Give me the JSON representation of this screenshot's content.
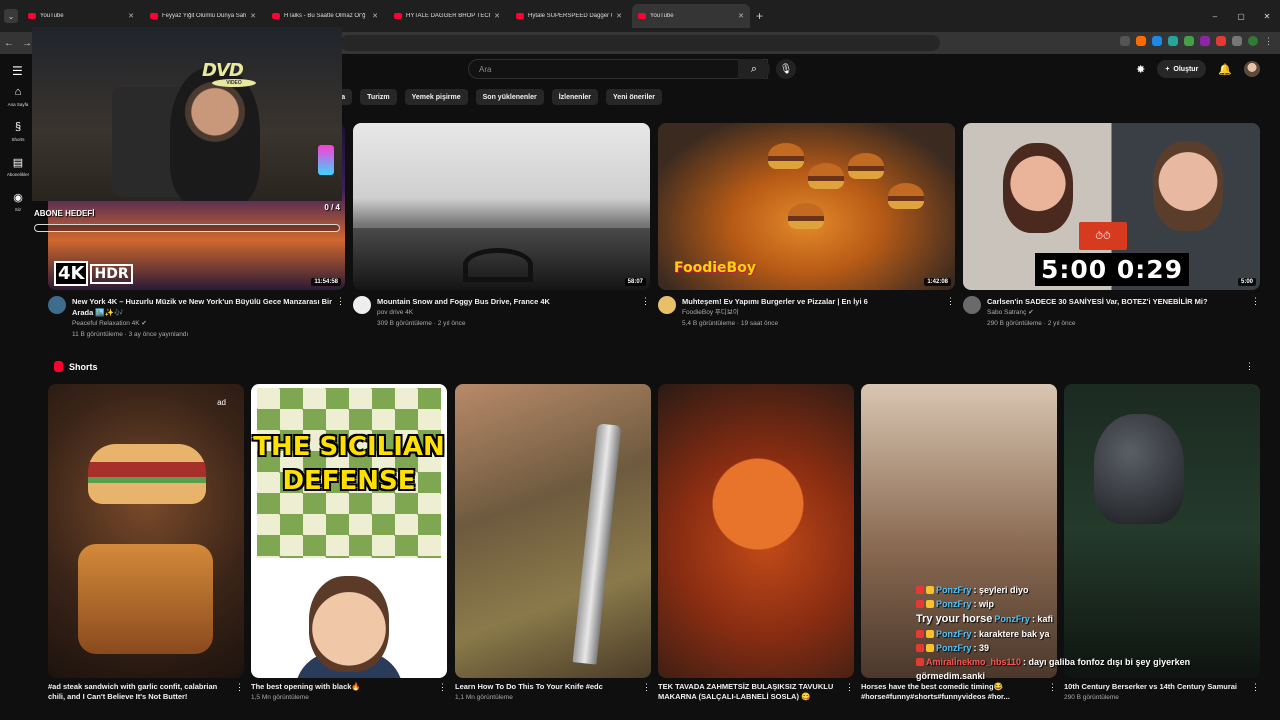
{
  "browser": {
    "tabs": [
      {
        "title": "YouTube",
        "active": false
      },
      {
        "title": "Feyyaz Yiğit Ölümlü Dünya Sah",
        "active": false
      },
      {
        "title": "HTalks - Bu Saatte Olmaz Or'ğ",
        "active": false
      },
      {
        "title": "HYTALE DAGGER BHOP TECH -",
        "active": false
      },
      {
        "title": "Hytale SUPERSPEED Dagger Co",
        "active": false
      },
      {
        "title": "YouTube",
        "active": true
      }
    ],
    "new_tab_label": "+",
    "window_controls": [
      "–",
      "▢",
      "✕"
    ]
  },
  "youtube": {
    "search": {
      "placeholder": "Ara"
    },
    "create_label": "Oluştur",
    "sidebar": [
      {
        "icon": "home-icon",
        "glyph": "⌂",
        "label": "Ana Sayfa"
      },
      {
        "icon": "shorts-icon",
        "glyph": "§",
        "label": "Shorts"
      },
      {
        "icon": "subscriptions-icon",
        "glyph": "▤",
        "label": "Abonelikler"
      },
      {
        "icon": "you-icon",
        "glyph": "◉",
        "label": "Siz"
      }
    ],
    "chips": [
      "ğa",
      "Turizm",
      "Yemek pişirme",
      "Son yüklenenler",
      "İzlenenler",
      "Yeni öneriler"
    ],
    "videos": [
      {
        "title": "New York 4K – Huzurlu Müzik ve New York'un Büyülü Gece Manzarası Bir Arada 🏙️✨🎶",
        "channel": "Peaceful Relaxation 4K ✔",
        "stats": "11 B görüntüleme · 3 ay önce yayınlandı",
        "duration": "11:54:58",
        "badge_4k": "4K",
        "badge_hdr": "HDR"
      },
      {
        "title": "Mountain Snow and Foggy Bus Drive, France 4K",
        "channel": "pov drive 4K",
        "stats": "309 B görüntüleme · 2 yıl önce",
        "duration": "58:07"
      },
      {
        "title": "Muhteşem! Ev Yapımı Burgerler ve Pizzalar | En İyi 6",
        "channel": "FoodieBoy 푸디보이",
        "stats": "5,4 B görüntüleme · 19 saat önce",
        "duration": "1:42:08",
        "logo": "FoodieBoy"
      },
      {
        "title": "Carlsen'in SADECE 30 SANİYESİ Var, BOTEZ'i YENEBİLİR Mi?",
        "channel": "Sabo Satranç ✔",
        "stats": "290 B görüntüleme · 2 yıl önce",
        "duration": "5:00",
        "timer_text": "5:00 0:29"
      }
    ],
    "shorts": {
      "heading": "Shorts",
      "items": [
        {
          "title": "#ad steak sandwich with garlic confit, calabrian chili, and I Can't Believe It's Not Butter!",
          "views": "",
          "ad": "ad"
        },
        {
          "title": "The best opening with black🔥",
          "views": "1,5 Mn görüntüleme",
          "thumb_text": "THE SICILIAN DEFENSE"
        },
        {
          "title": "Learn How To Do This To Your Knife #edc",
          "views": "1,1 Mn görüntüleme"
        },
        {
          "title": "TEK TAVADA ZAHMETSİZ BULAŞIKSIZ TAVUKLU MAKARNA (SALÇALI-LABNELİ SOSLA) 😋",
          "views": ""
        },
        {
          "title": "Horses have the best comedic timing😂 #horse#funny#shorts#funnyvideos #hor...",
          "views": ""
        },
        {
          "title": "10th Century Berserker vs 14th Century Samurai",
          "views": "290 B görüntüleme"
        }
      ]
    }
  },
  "stream_overlay": {
    "logo_text": "DVD",
    "logo_sub": "VIDEO",
    "sub_goal_label": "ABONE HEDEFİ",
    "sub_goal_count": "0 / 4",
    "sub_goal_progress": 0,
    "chat": [
      {
        "user": "PonzFry",
        "msg": ": şeyleri diyo"
      },
      {
        "user": "PonzFry",
        "msg": ": wip"
      },
      {
        "user": "PonzFry",
        "msg": ": kafi",
        "prefix": "Try your horse"
      },
      {
        "user": "PonzFry",
        "msg": ": karaktere bak ya"
      },
      {
        "user": "PonzFry",
        "msg": ": 39"
      },
      {
        "user": "Amiralİnekmo_hbs110",
        "msg": ": dayı galiba fonfoz dışı bi şey giyerken",
        "red": true
      },
      {
        "user": "",
        "msg": "görmedim.sanki"
      }
    ]
  },
  "colors": {
    "background": "#0f0f0f",
    "accent": "#ff0033",
    "chip_bg": "#272727",
    "chat_user": "#4fc3f7"
  }
}
